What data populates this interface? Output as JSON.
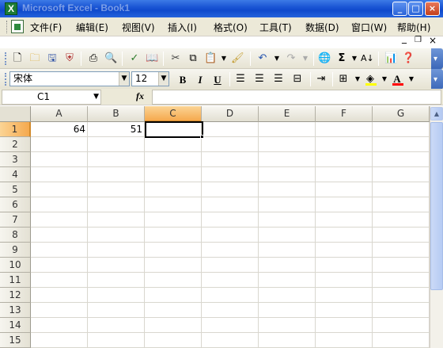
{
  "window": {
    "title": "Microsoft Excel - Book1",
    "app_icon_letter": "X"
  },
  "window_controls": {
    "minimize": "_",
    "maximize": "□",
    "close": "×"
  },
  "menu": {
    "items": [
      "文件(F)",
      "编辑(E)",
      "视图(V)",
      "插入(I)",
      "格式(O)",
      "工具(T)",
      "数据(D)",
      "窗口(W)",
      "帮助(H)"
    ],
    "doc_minimize": "_",
    "doc_restore": "❐",
    "doc_close": "×"
  },
  "format_toolbar": {
    "font_name": "宋体",
    "font_size": "12",
    "bold": "B",
    "italic": "I",
    "underline": "U",
    "fill_color": "#ffff00",
    "font_color": "#ff0000"
  },
  "formula_bar": {
    "name_box": "C1",
    "fx_label": "fx",
    "formula": ""
  },
  "sheet": {
    "columns": [
      "A",
      "B",
      "C",
      "D",
      "E",
      "F",
      "G"
    ],
    "rows": [
      "1",
      "2",
      "3",
      "4",
      "5",
      "6",
      "7",
      "8",
      "9",
      "10",
      "11",
      "12",
      "13",
      "14",
      "15"
    ],
    "selected_cell": "C1",
    "cells": {
      "A1": "64",
      "B1": "51"
    }
  },
  "scrollbar": {
    "up_arrow": "▲"
  },
  "colors": {
    "title_bar": "#1b56d4",
    "selected_header": "#f5a94e",
    "chrome": "#ece9d8"
  }
}
